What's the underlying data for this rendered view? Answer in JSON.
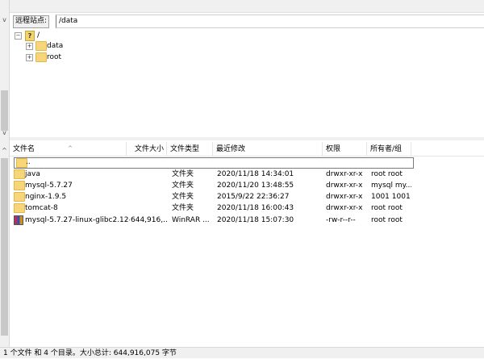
{
  "remote": {
    "label": "远程站点:",
    "path": "/data"
  },
  "tree": {
    "root": "/",
    "items": [
      {
        "label": "data",
        "expander": "+"
      },
      {
        "label": "root",
        "expander": "+"
      }
    ]
  },
  "list": {
    "headers": {
      "name": "文件名",
      "size": "文件大小",
      "type": "文件类型",
      "modified": "最近修改",
      "perms": "权限",
      "owner": "所有者/组"
    },
    "parent": "..",
    "rows": [
      {
        "name": "java",
        "size": "",
        "type": "文件夹",
        "modified": "2020/11/18 14:34:01",
        "perms": "drwxr-xr-x",
        "owner": "root root",
        "icon": "folder-icon"
      },
      {
        "name": "mysql-5.7.27",
        "size": "",
        "type": "文件夹",
        "modified": "2020/11/20 13:48:55",
        "perms": "drwxr-xr-x",
        "owner": "mysql my...",
        "icon": "folder-icon"
      },
      {
        "name": "nginx-1.9.5",
        "size": "",
        "type": "文件夹",
        "modified": "2015/9/22 22:36:27",
        "perms": "drwxr-xr-x",
        "owner": "1001 1001",
        "icon": "folder-icon"
      },
      {
        "name": "tomcat-8",
        "size": "",
        "type": "文件夹",
        "modified": "2020/11/18 16:00:43",
        "perms": "drwxr-xr-x",
        "owner": "root root",
        "icon": "folder-icon"
      },
      {
        "name": "mysql-5.7.27-linux-glibc2.12-...",
        "size": "644,916,...",
        "type": "WinRAR ...",
        "modified": "2020/11/18 15:07:30",
        "perms": "-rw-r--r--",
        "owner": "root root",
        "icon": "winrar-archive-icon"
      }
    ]
  },
  "status": "1 个文件 和 4 个目录。大小总计: 644,916,075 字节"
}
